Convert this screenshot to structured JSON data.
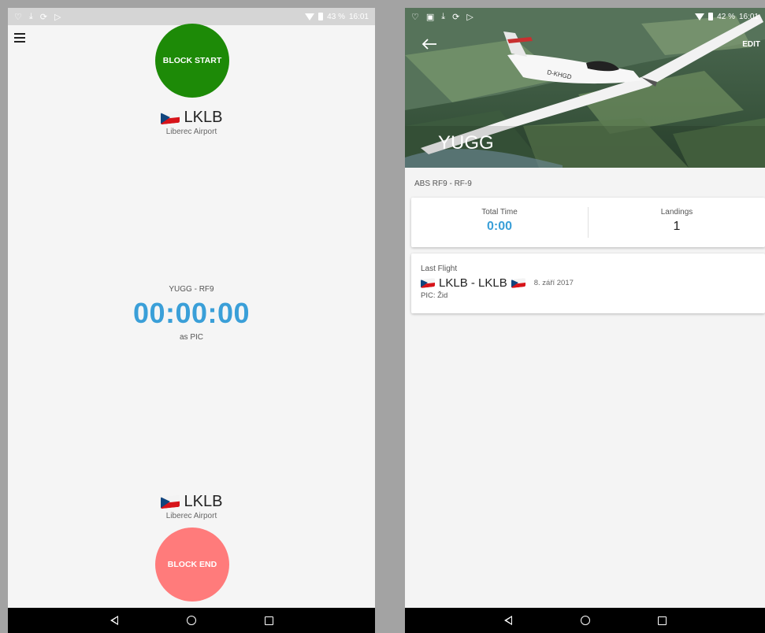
{
  "left_screen": {
    "status_bar": {
      "battery": "43 %",
      "time": "16:01",
      "icons": [
        "heart-icon",
        "download-icon",
        "sync-icon",
        "play-icon"
      ]
    },
    "menu_icon": "hamburger-menu-icon",
    "block_start_label": "BLOCK START",
    "departure": {
      "code": "LKLB",
      "name": "Liberec Airport",
      "flag": "czech-flag-icon"
    },
    "aircraft": "YUGG - RF9",
    "timer": "00:00:00",
    "role": "as PIC",
    "arrival": {
      "code": "LKLB",
      "name": "Liberec Airport",
      "flag": "czech-flag-icon"
    },
    "block_end_label": "BLOCK END",
    "colors": {
      "start": "#1d8a07",
      "end": "#ff7b7b",
      "timer": "#3a9fd8"
    }
  },
  "right_screen": {
    "status_bar": {
      "battery": "42 %",
      "time": "16:01",
      "icons": [
        "heart-icon",
        "image-icon",
        "download-icon",
        "sync-icon",
        "play-icon"
      ]
    },
    "edit_label": "EDIT",
    "title": "YUGG",
    "subtitle": "ABS RF9 - RF-9",
    "stats": {
      "total_time_label": "Total Time",
      "total_time_value": "0:00",
      "landings_label": "Landings",
      "landings_value": "1"
    },
    "last_flight": {
      "label": "Last Flight",
      "route": "LKLB - LKLB",
      "date": "8. září 2017",
      "pic": "PIC: Žid"
    },
    "aircraft_registration": "D-KHGD"
  },
  "nav_bar": [
    "back-icon",
    "home-icon",
    "recents-icon"
  ]
}
